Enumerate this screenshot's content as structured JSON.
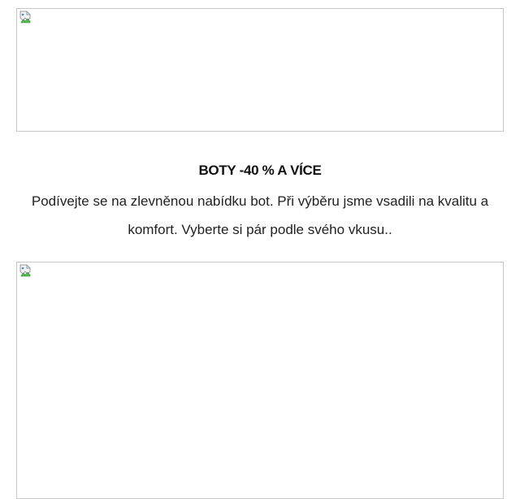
{
  "promo": {
    "heading": "BOTY -40 % A VÍCE",
    "text": "Podívejte se na zlevněnou nabídku bot. Při výběru jsme vsadili na kvalitu a komfort. Vyberte si pár podle svého vkusu.."
  },
  "images": {
    "top_icon": "broken-image-icon",
    "bottom_icon": "broken-image-icon"
  },
  "colors": {
    "border": "#c8c8c8",
    "text": "#111111",
    "background": "#ffffff"
  }
}
